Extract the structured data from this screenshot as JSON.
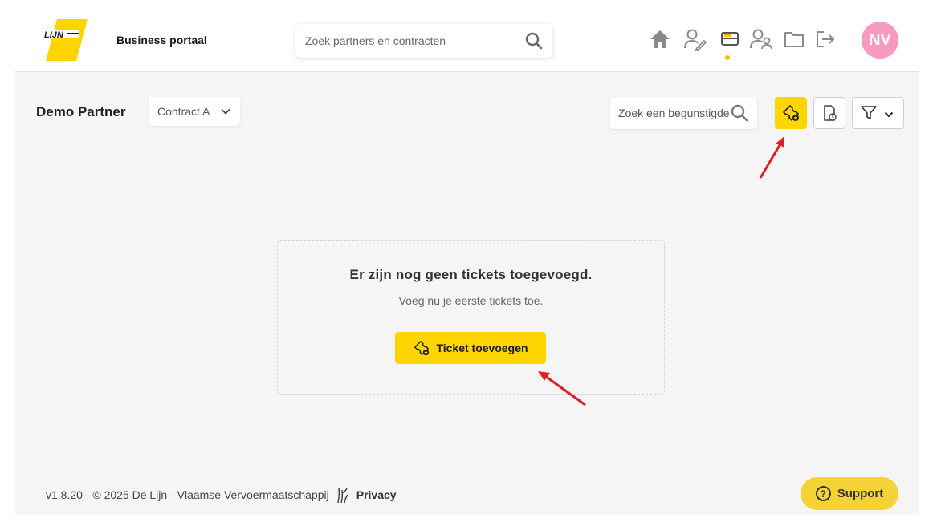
{
  "header": {
    "logo_text": "LIJN",
    "brand_title": "Business portaal",
    "search_placeholder": "Zoek partners en contracten",
    "nav_icons": [
      "home-icon",
      "user-edit-icon",
      "ticket-card-icon",
      "users-icon",
      "folder-icon",
      "logout-icon"
    ],
    "active_nav": "ticket-card-icon",
    "avatar_initials": "NV"
  },
  "toolbar": {
    "partner_name": "Demo Partner",
    "contract_value": "Contract A",
    "beneficiary_search_placeholder": "Zoek een begunstigde"
  },
  "empty_state": {
    "title": "Er zijn nog geen tickets toegevoegd.",
    "subtitle": "Voeg nu je eerste tickets toe.",
    "button_label": "Ticket toevoegen"
  },
  "footer": {
    "text": "v1.8.20 - © 2025 De Lijn - Vlaamse Vervoermaatschappij",
    "privacy_label": "Privacy"
  },
  "support": {
    "label": "Support"
  },
  "colors": {
    "accent_yellow": "#ffd500",
    "avatar_pink": "#f79ac0",
    "annotation_red": "#e02020",
    "background": "#f5f5f5"
  }
}
